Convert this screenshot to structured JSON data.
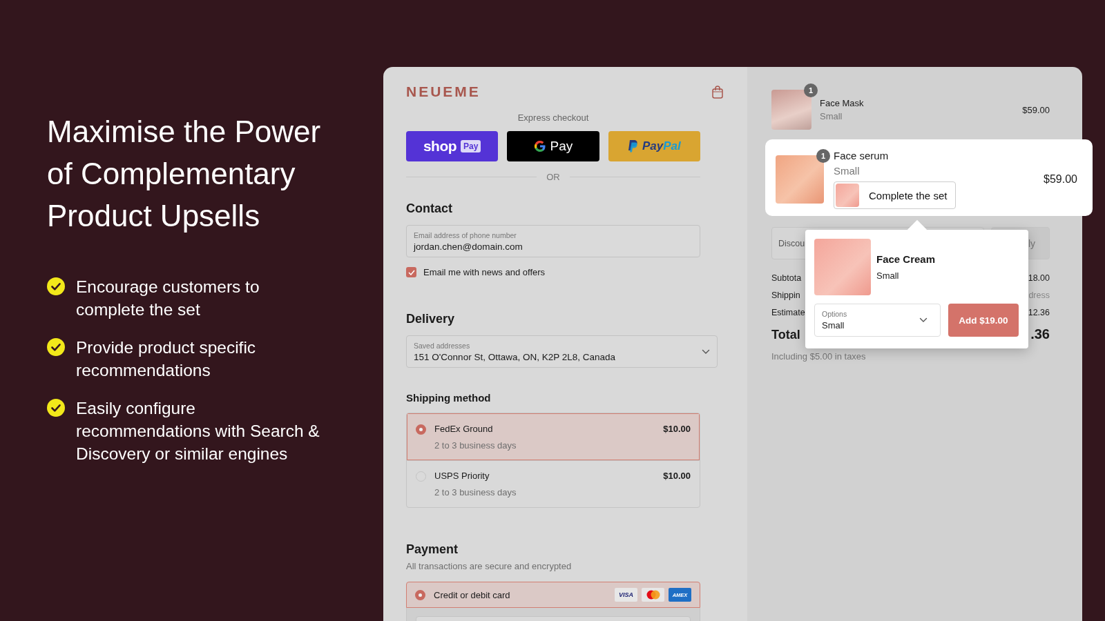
{
  "hero": {
    "title": "Maximise the Power of Complementary Product Upsells",
    "bullets": [
      "Encourage customers to complete the set",
      "Provide product specific recommendations",
      "Easily configure recommendations with Search & Discovery or similar engines"
    ]
  },
  "checkout": {
    "brand": "NEUEME",
    "express_label": "Express checkout",
    "express_buttons": [
      {
        "kind": "shop",
        "label": "shop",
        "badge": "Pay"
      },
      {
        "kind": "gpay",
        "label": "Pay"
      },
      {
        "kind": "paypal",
        "label": "Pay",
        "label_2": "Pal"
      }
    ],
    "divider": "OR",
    "contact": {
      "heading": "Contact",
      "field_label": "Email address of phone number",
      "value": "jordan.chen@domain.com",
      "newsletter": {
        "label": "Email me with news and offers",
        "checked": true
      }
    },
    "delivery": {
      "heading": "Delivery",
      "field_label": "Saved addresses",
      "value": "151 O'Connor St, Ottawa, ON, K2P 2L8, Canada"
    },
    "shipping": {
      "heading": "Shipping method",
      "options": [
        {
          "name": "FedEx Ground",
          "detail": "2 to 3 business days",
          "price": "$10.00",
          "selected": true
        },
        {
          "name": "USPS Priority",
          "detail": "2 to 3 business days",
          "price": "$10.00",
          "selected": false
        }
      ]
    },
    "payment": {
      "heading": "Payment",
      "subtitle": "All transactions are secure and encrypted",
      "methods": [
        {
          "label": "Credit or debit card",
          "selected": true
        }
      ],
      "card_brands": [
        {
          "kind": "visa",
          "label": "VISA"
        },
        {
          "kind": "mastercard"
        },
        {
          "kind": "amex",
          "label": "AMEX"
        }
      ]
    }
  },
  "summary": {
    "items": [
      {
        "kind": "plain",
        "name": "Face Mask",
        "variant": "Small",
        "price": "$59.00",
        "quantity": "1"
      },
      {
        "kind": "highlight",
        "name": "Face serum",
        "variant": "Small",
        "price": "$59.00",
        "quantity": "1",
        "upsell_button": "Complete the set"
      }
    ],
    "upsell_popup": {
      "name": "Face Cream",
      "variant": "Small",
      "options_label": "Options",
      "options_value": "Small",
      "add_button": "Add $19.00"
    },
    "discount": {
      "placeholder": "Discou",
      "apply": "ly"
    },
    "rows": [
      {
        "label": "Subtota",
        "value": "18.00",
        "muted": false
      },
      {
        "label": "Shippin",
        "value": "dress",
        "muted": true
      },
      {
        "label": "Estimate",
        "value": "12.36",
        "muted": false
      }
    ],
    "total": {
      "label": "Total",
      "value": ".36"
    },
    "tax_note": "Including $5.00 in taxes"
  }
}
